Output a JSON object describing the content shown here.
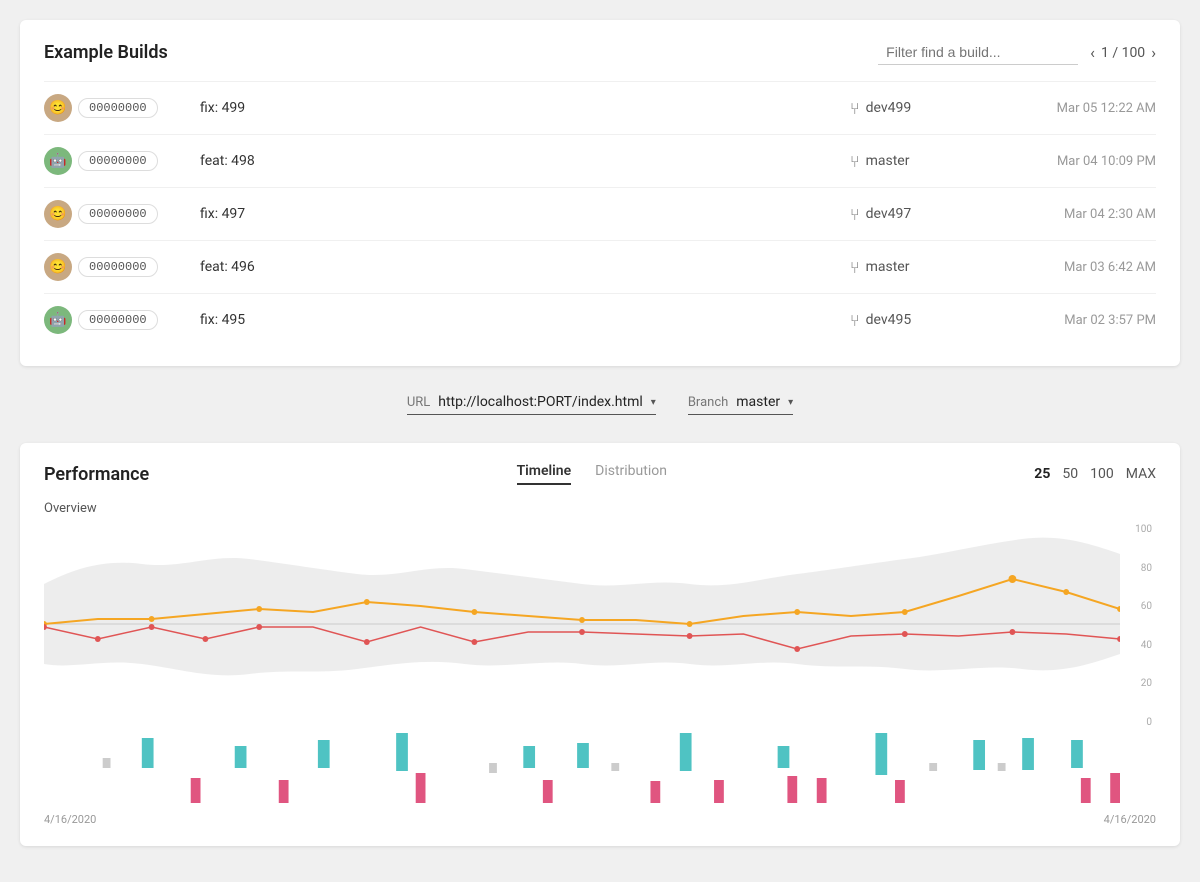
{
  "page": {
    "title": "Example Builds"
  },
  "filter": {
    "placeholder": "Filter find a build..."
  },
  "pagination": {
    "current": 1,
    "total": 100,
    "display": "1 / 100"
  },
  "builds": [
    {
      "id": "build-1",
      "commit": "00000000",
      "avatar_type": "human",
      "name": "fix: 499",
      "branch": "dev499",
      "date": "Mar 05 12:22 AM"
    },
    {
      "id": "build-2",
      "commit": "00000000",
      "avatar_type": "bot",
      "name": "feat: 498",
      "branch": "master",
      "date": "Mar 04 10:09 PM"
    },
    {
      "id": "build-3",
      "commit": "00000000",
      "avatar_type": "human",
      "name": "fix: 497",
      "branch": "dev497",
      "date": "Mar 04 2:30 AM"
    },
    {
      "id": "build-4",
      "commit": "00000000",
      "avatar_type": "human",
      "name": "feat: 496",
      "branch": "master",
      "date": "Mar 03 6:42 AM"
    },
    {
      "id": "build-5",
      "commit": "00000000",
      "avatar_type": "bot",
      "name": "fix: 495",
      "branch": "dev495",
      "date": "Mar 02 3:57 PM"
    }
  ],
  "controls": {
    "url_label": "URL",
    "url_value": "http://localhost:PORT/index.html",
    "branch_label": "Branch",
    "branch_value": "master"
  },
  "performance": {
    "title": "Performance",
    "tabs": [
      "Timeline",
      "Distribution"
    ],
    "active_tab": "Timeline",
    "counts": [
      "25",
      "50",
      "100",
      "MAX"
    ],
    "active_count": "25",
    "overview_label": "Overview",
    "date_start": "4/16/2020",
    "date_end": "4/16/2020",
    "y_axis": [
      "100",
      "80",
      "60",
      "40",
      "20",
      "0"
    ]
  }
}
